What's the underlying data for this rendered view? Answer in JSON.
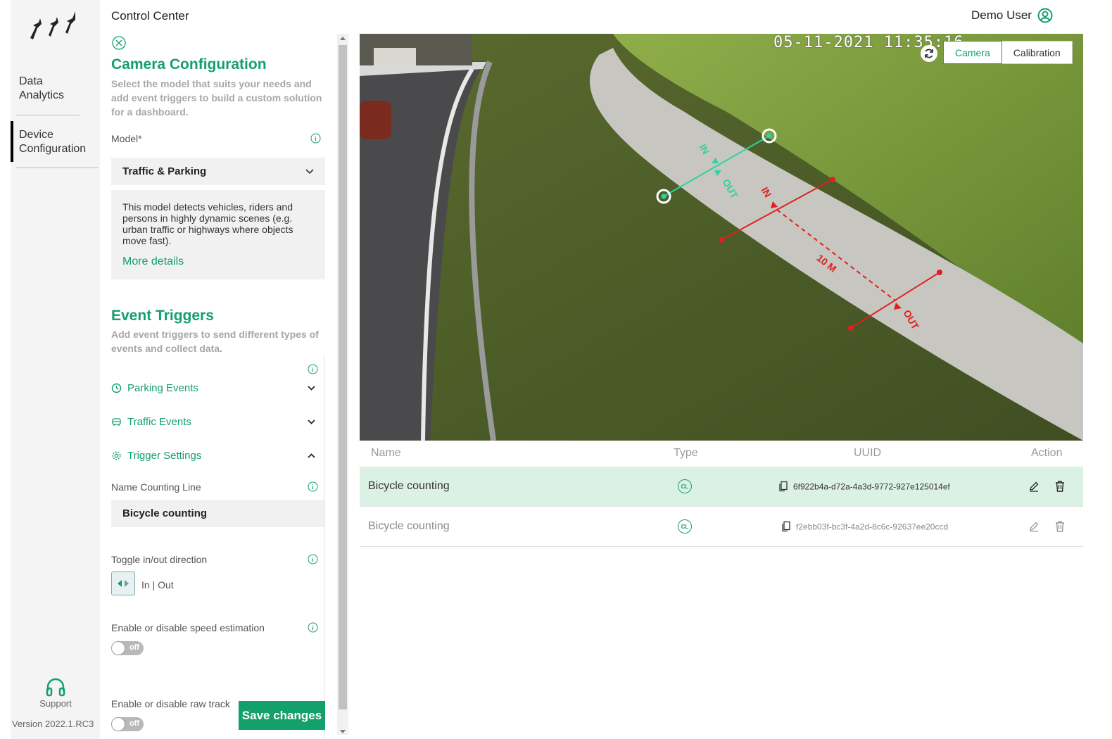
{
  "header": {
    "app_title": "Control Center",
    "user_name": "Demo User"
  },
  "sidebar": {
    "items": [
      {
        "label": "Data Analytics"
      },
      {
        "label": "Device Configuration"
      }
    ],
    "support_label": "Support",
    "version": "Version 2022.1.RC3"
  },
  "config": {
    "title": "Camera Configuration",
    "subtitle": "Select the model that suits your needs and add event triggers to build a custom solution for a dashboard.",
    "model_label": "Model*",
    "model_value": "Traffic & Parking",
    "model_description": "This model detects vehicles, riders and persons in highly dynamic scenes (e.g. urban traffic or highways where objects move fast).",
    "more_details": "More details",
    "event_triggers_title": "Event Triggers",
    "event_triggers_subtitle": "Add event triggers to send different types of events and collect data.",
    "accordions": [
      {
        "label": "Parking Events",
        "icon": "clock-icon",
        "expanded": false
      },
      {
        "label": "Traffic Events",
        "icon": "car-icon",
        "expanded": false
      },
      {
        "label": "Trigger Settings",
        "icon": "gear-icon",
        "expanded": true
      }
    ],
    "name_line_label": "Name Counting Line",
    "name_line_value": "Bicycle counting",
    "toggle_dir_label": "Toggle in/out direction",
    "dir_text": "In | Out",
    "speed_label": "Enable or disable speed estimation",
    "speed_state": "off",
    "raw_track_label": "Enable or disable raw track",
    "raw_track_state": "off",
    "save_label": "Save changes"
  },
  "camera": {
    "timestamp": "05-11-2021 11:35:16",
    "tabs": [
      "Camera",
      "Calibration"
    ],
    "active_tab": "Camera",
    "overlay_labels": {
      "in": "IN",
      "out": "OUT",
      "distance": "10 M"
    }
  },
  "table": {
    "headers": [
      "Name",
      "Type",
      "UUID",
      "Action"
    ],
    "rows": [
      {
        "name": "Bicycle counting",
        "type": "CL",
        "uuid": "6f922b4a-d72a-4a3d-9772-927e125014ef"
      },
      {
        "name": "Bicycle counting",
        "type": "CL",
        "uuid": "f2ebb03f-bc3f-4a2d-8c6c-92637ee20ccd"
      }
    ]
  },
  "colors": {
    "accent": "#13a06b",
    "counting_line_red": "#e02020",
    "selected_row": "#dcf1e6"
  }
}
